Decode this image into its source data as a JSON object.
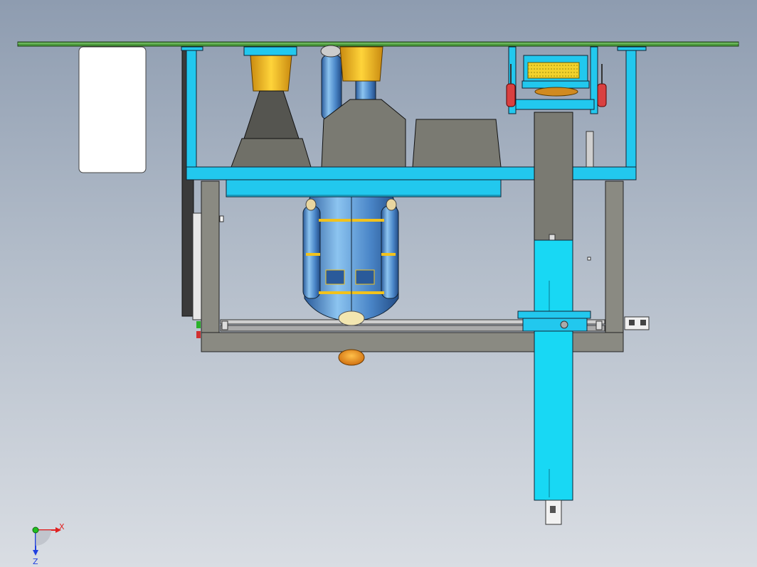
{
  "viewport": {
    "background_top": "#8e9cb0",
    "background_bottom": "#d9dde3"
  },
  "model": {
    "frame_color": "#22c8ee",
    "steel_color": "#8a8a82",
    "plate_color": "#4a9a3a",
    "figure_color": "#5a9ad8",
    "accent_yellow": "#f2c21c",
    "accent_red": "#d94040"
  },
  "triad": {
    "x_label": "X",
    "z_label": "Z",
    "x_color": "#e02020",
    "y_color": "#20c020",
    "z_color": "#2040e0"
  }
}
